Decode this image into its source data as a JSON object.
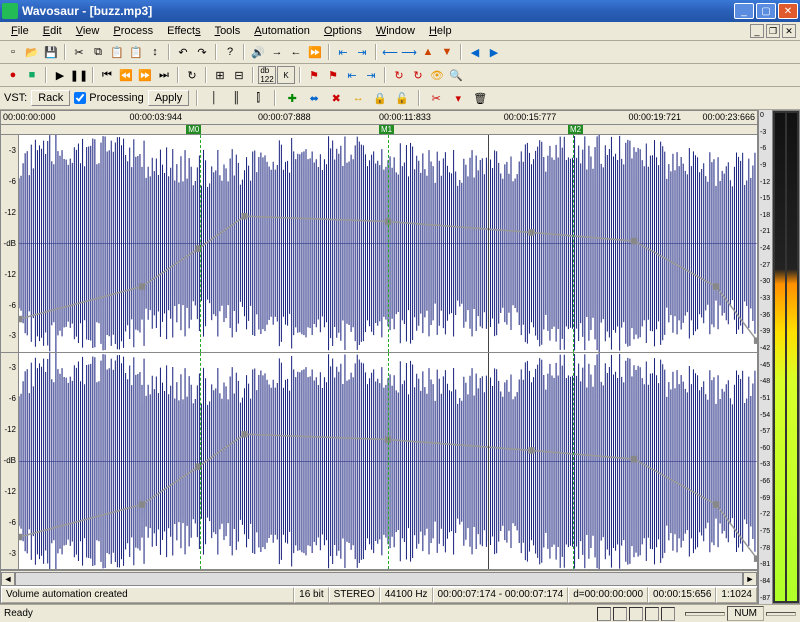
{
  "title": "Wavosaur - [buzz.mp3]",
  "menubar": [
    "File",
    "Edit",
    "View",
    "Process",
    "Effects",
    "Tools",
    "Automation",
    "Options",
    "Window",
    "Help"
  ],
  "vst_label": "VST:",
  "vst_rack": "Rack",
  "vst_proc": "Processing",
  "vst_apply": "Apply",
  "timeruler": [
    "00:00:00:000",
    "00:00:03:944",
    "00:00:07:888",
    "00:00:11:833",
    "00:00:15:777",
    "00:00:19:721"
  ],
  "timeruler_end": "00:00:23:666",
  "markers": [
    {
      "name": "M0",
      "pos": 24.5
    },
    {
      "name": "M1",
      "pos": 50
    },
    {
      "name": "M2",
      "pos": 75
    }
  ],
  "cursor_pos": 63.5,
  "db_labels": [
    "-3",
    "-6",
    "-12",
    "-dB",
    "-12",
    "-6",
    "-3"
  ],
  "status": {
    "msg": "Volume automation created",
    "bit": "16 bit",
    "stereo": "STEREO",
    "rate": "44100 Hz",
    "sel": "00:00:07:174 - 00:00:07:174",
    "dur": "d=00:00:00:000",
    "len": "00:00:15:656",
    "zoom": "1:1024"
  },
  "bottom": {
    "ready": "Ready",
    "num": "NUM"
  },
  "meterscale": [
    "0",
    "-3",
    "-6",
    "-9",
    "-12",
    "-15",
    "-18",
    "-21",
    "-24",
    "-27",
    "-30",
    "-33",
    "-36",
    "-39",
    "-42",
    "-45",
    "-48",
    "-51",
    "-54",
    "-57",
    "-60",
    "-63",
    "-66",
    "-69",
    "-72",
    "-75",
    "-78",
    "-81",
    "-84",
    "-87"
  ],
  "icons": {
    "new": "▫",
    "open": "📂",
    "save": "💾",
    "cut": "✂",
    "copy": "⧉",
    "paste": "📋",
    "paste2": "📋",
    "arr": "↕",
    "undo": "↶",
    "redo": "↷",
    "help": "?",
    "vol": "🔊",
    "rarr": "→",
    "larr": "←",
    "fwd": "⏩",
    "b1": "⇤",
    "b2": "⇥",
    "b3": "⟵",
    "b4": "⟶",
    "t1": "▲",
    "t2": "▼",
    "t3": "◀",
    "t4": "▶",
    "rec": "●",
    "stop": "■",
    "play": "▶",
    "pause": "❚❚",
    "prev": "⏮",
    "rew": "⏪",
    "ff": "⏩",
    "next": "⏭",
    "loop": "↻",
    "s1": "⊞",
    "s2": "⊟",
    "kick": "K",
    "p1": "✚",
    "p2": "⬌",
    "p3": "✖",
    "p4": "↔",
    "mark": "⚑",
    "x": "✖",
    "lock": "🔒",
    "lock2": "🔓",
    "sc": "✂",
    "dn": "▾",
    "tr": "🗑",
    "eye": "👁",
    "mag": "🔍",
    "l1": "│",
    "l2": "║",
    "l3": "⫿"
  }
}
